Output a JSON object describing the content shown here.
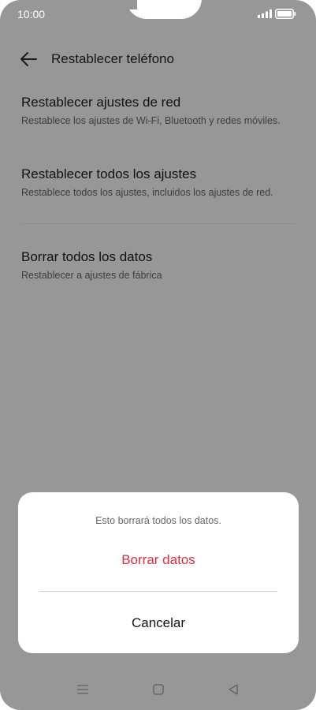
{
  "status_bar": {
    "time": "10:00",
    "icons": [
      "signal-icon",
      "battery-icon"
    ]
  },
  "header": {
    "title": "Restablecer teléfono",
    "back_icon": "back-arrow-icon"
  },
  "options": [
    {
      "title": "Restablecer ajustes de red",
      "description": "Restablece los ajustes de Wi-Fi, Bluetooth y redes móviles."
    },
    {
      "title": "Restablecer todos los ajustes",
      "description": "Restablece todos los ajustes, incluidos los ajustes de red."
    },
    {
      "title": "Borrar todos los datos",
      "description": "Restablecer a ajustes de fábrica"
    }
  ],
  "dialog": {
    "message": "Esto borrará todos los datos.",
    "confirm_label": "Borrar datos",
    "cancel_label": "Cancelar"
  },
  "nav_bar": {
    "icons": [
      "menu-icon",
      "home-icon",
      "back-icon"
    ]
  },
  "colors": {
    "overlay": "#979797",
    "destructive": "#dd2e44",
    "dialog_bg": "#ffffff"
  }
}
